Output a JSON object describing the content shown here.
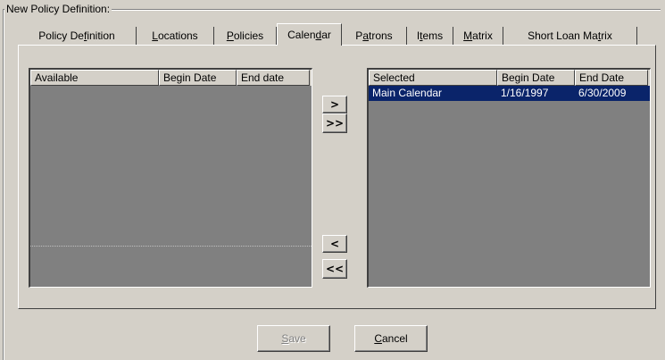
{
  "group_title": "New  Policy Definition:",
  "tabs": [
    {
      "before": "Policy De",
      "key": "f",
      "after": "inition"
    },
    {
      "before": "",
      "key": "L",
      "after": "ocations"
    },
    {
      "before": "",
      "key": "P",
      "after": "olicies"
    },
    {
      "before": "Calen",
      "key": "d",
      "after": "ar"
    },
    {
      "before": "P",
      "key": "a",
      "after": "trons"
    },
    {
      "before": "I",
      "key": "t",
      "after": "ems"
    },
    {
      "before": "",
      "key": "M",
      "after": "atrix"
    },
    {
      "before": "Short Loan Ma",
      "key": "t",
      "after": "rix"
    }
  ],
  "active_tab": "Calendar",
  "available": {
    "columns": [
      "Available",
      "Begin Date",
      "End date"
    ],
    "rows": []
  },
  "selected": {
    "columns": [
      "Selected",
      "Begin Date",
      "End Date"
    ],
    "rows": [
      {
        "name": "Main Calendar",
        "begin": "1/16/1997",
        "end": "6/30/2009"
      }
    ]
  },
  "move_buttons": {
    "add_one": ">",
    "add_all": ">>",
    "remove_one": "<",
    "remove_all": "<<"
  },
  "footer": {
    "save": {
      "key": "S",
      "rest": "ave",
      "enabled": false
    },
    "cancel": {
      "key": "C",
      "rest": "ancel",
      "enabled": true
    }
  }
}
